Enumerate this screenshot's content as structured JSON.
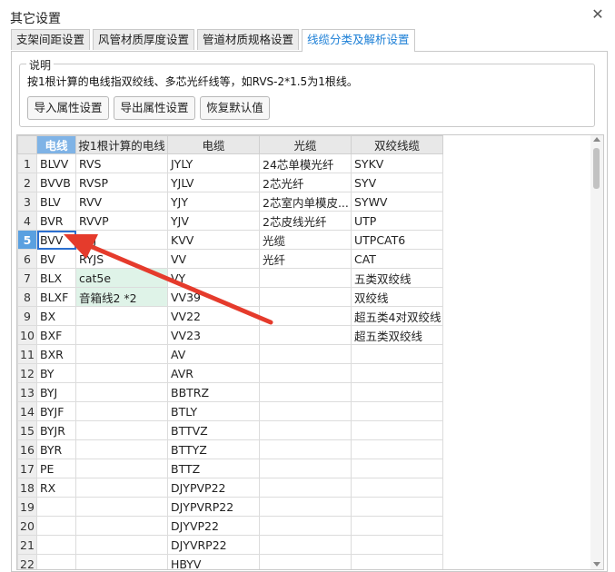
{
  "window": {
    "title": "其它设置"
  },
  "tabs": [
    {
      "label": "支架间距设置"
    },
    {
      "label": "风管材质厚度设置"
    },
    {
      "label": "管道材质规格设置"
    },
    {
      "label": "线缆分类及解析设置",
      "active": true
    }
  ],
  "description": {
    "legend": "说明",
    "text": "按1根计算的电线指双绞线、多芯光纤线等，如RVS-2*1.5为1根线。"
  },
  "buttons": {
    "import": "导入属性设置",
    "export": "导出属性设置",
    "restore": "恢复默认值"
  },
  "grid": {
    "columns": [
      "电线",
      "按1根计算的电线",
      "电缆",
      "光缆",
      "双绞线缆"
    ],
    "rows": [
      [
        "1",
        "BLVV",
        "RVS",
        "JYLY",
        "24芯单模光纤",
        "SYKV"
      ],
      [
        "2",
        "BVVB",
        "RVSP",
        "YJLV",
        "2芯光纤",
        "SYV"
      ],
      [
        "3",
        "BLV",
        "RVV",
        "YJY",
        "2芯室内单模皮...",
        "SYWV"
      ],
      [
        "4",
        "BVR",
        "RVVP",
        "YJV",
        "2芯皮线光纤",
        "UTP"
      ],
      [
        "5",
        "BVV",
        "RYJ",
        "KVV",
        "光缆",
        "UTPCAT6"
      ],
      [
        "6",
        "BV",
        "RYJS",
        "VV",
        "光纤",
        "CAT"
      ],
      [
        "7",
        "BLX",
        "cat5e",
        "VY",
        "",
        "五类双绞线"
      ],
      [
        "8",
        "BLXF",
        "音箱线2 *2",
        "VV39",
        "",
        "双绞线"
      ],
      [
        "9",
        "BX",
        "",
        "VV22",
        "",
        "超五类4对双绞线"
      ],
      [
        "10",
        "BXF",
        "",
        "VV23",
        "",
        "超五类双绞线"
      ],
      [
        "11",
        "BXR",
        "",
        "AV",
        "",
        ""
      ],
      [
        "12",
        "BY",
        "",
        "AVR",
        "",
        ""
      ],
      [
        "13",
        "BYJ",
        "",
        "BBTRZ",
        "",
        ""
      ],
      [
        "14",
        "BYJF",
        "",
        "BTLY",
        "",
        ""
      ],
      [
        "15",
        "BYJR",
        "",
        "BTTVZ",
        "",
        ""
      ],
      [
        "16",
        "BYR",
        "",
        "BTTYZ",
        "",
        ""
      ],
      [
        "17",
        "PE",
        "",
        "BTTZ",
        "",
        ""
      ],
      [
        "18",
        "RX",
        "",
        "DJYPVP22",
        "",
        ""
      ],
      [
        "19",
        "",
        "",
        "DJYPVRP22",
        "",
        ""
      ],
      [
        "20",
        "",
        "",
        "DJYVP22",
        "",
        ""
      ],
      [
        "21",
        "",
        "",
        "DJYVRP22",
        "",
        ""
      ],
      [
        "22",
        "",
        "",
        "HBYV",
        "",
        ""
      ]
    ],
    "selected_row": 5,
    "green_cells": [
      [
        7,
        2
      ],
      [
        8,
        2
      ]
    ]
  },
  "colors": {
    "accent": "#1c7fd6",
    "header_highlight": "#7fb3e6",
    "green_cell": "#dff3e8",
    "annotation_arrow": "#e53b2c"
  }
}
